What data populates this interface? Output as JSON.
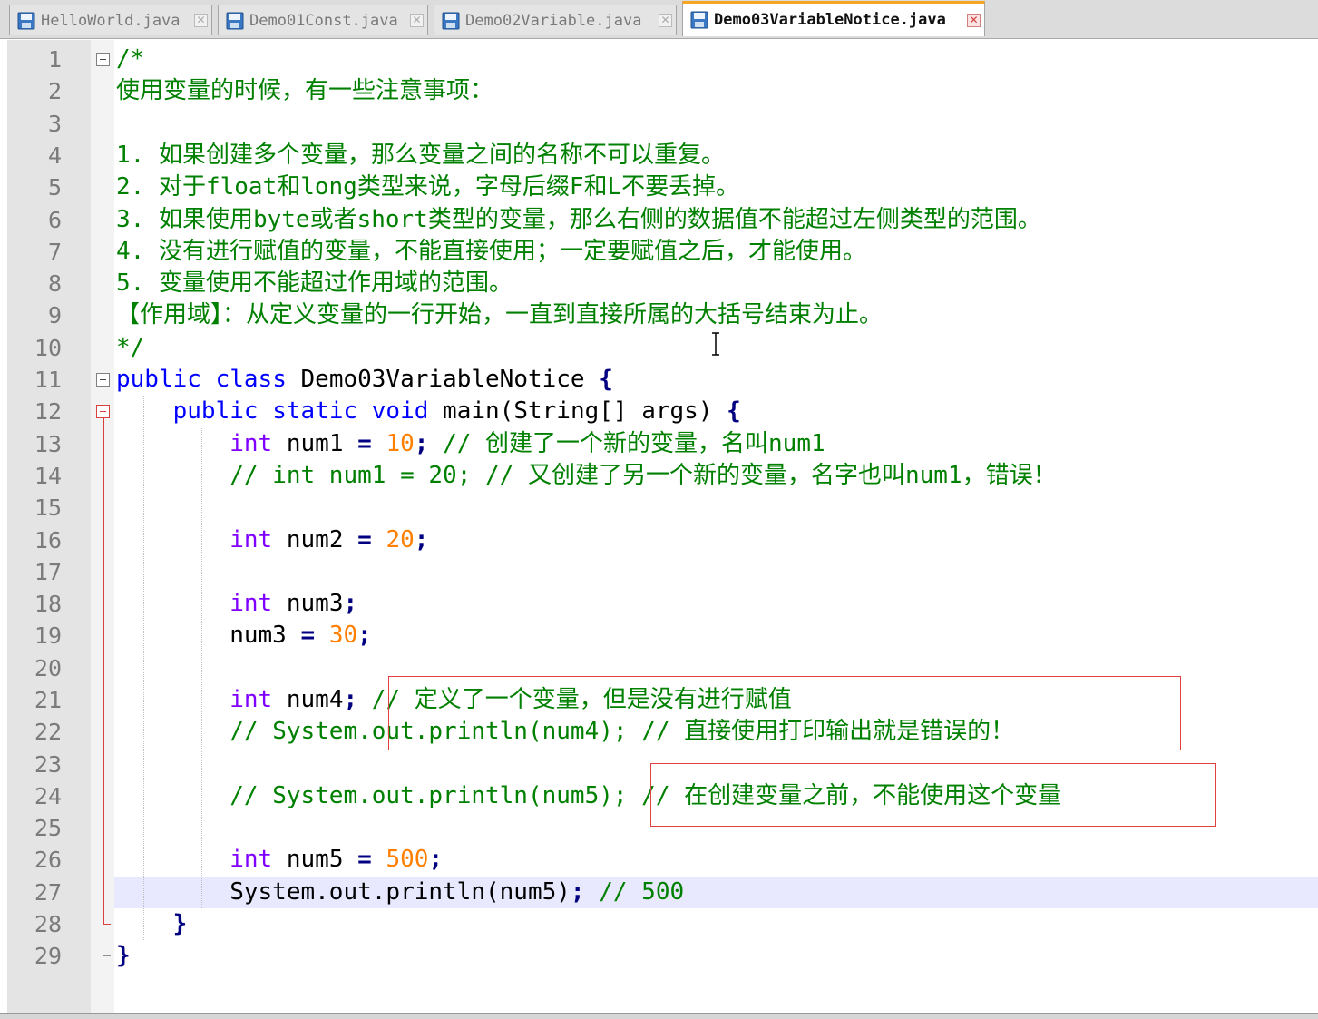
{
  "tabs": [
    {
      "label": "HelloWorld.java",
      "active": false
    },
    {
      "label": "Demo01Const.java",
      "active": false
    },
    {
      "label": "Demo02Variable.java",
      "active": false
    },
    {
      "label": "Demo03VariableNotice.java",
      "active": true
    }
  ],
  "editor": {
    "current_line": 27,
    "lines": [
      {
        "n": "1",
        "tokens": [
          [
            "cmt",
            "/*"
          ]
        ]
      },
      {
        "n": "2",
        "tokens": [
          [
            "cmt",
            "使用变量的时候，有一些注意事项："
          ]
        ]
      },
      {
        "n": "3",
        "tokens": []
      },
      {
        "n": "4",
        "tokens": [
          [
            "cmt",
            "1. 如果创建多个变量，那么变量之间的名称不可以重复。"
          ]
        ]
      },
      {
        "n": "5",
        "tokens": [
          [
            "cmt",
            "2. 对于float和long类型来说，字母后缀F和L不要丢掉。"
          ]
        ]
      },
      {
        "n": "6",
        "tokens": [
          [
            "cmt",
            "3. 如果使用byte或者short类型的变量，那么右侧的数据值不能超过左侧类型的范围。"
          ]
        ]
      },
      {
        "n": "7",
        "tokens": [
          [
            "cmt",
            "4. 没有进行赋值的变量，不能直接使用；一定要赋值之后，才能使用。"
          ]
        ]
      },
      {
        "n": "8",
        "tokens": [
          [
            "cmt",
            "5. 变量使用不能超过作用域的范围。"
          ]
        ]
      },
      {
        "n": "9",
        "tokens": [
          [
            "cmt",
            "【作用域】：从定义变量的一行开始，一直到直接所属的大括号结束为止。"
          ]
        ]
      },
      {
        "n": "10",
        "tokens": [
          [
            "cmt",
            "*/"
          ]
        ]
      },
      {
        "n": "11",
        "tokens": [
          [
            "kw",
            "public"
          ],
          [
            "txt",
            " "
          ],
          [
            "kw",
            "class"
          ],
          [
            "txt",
            " Demo03VariableNotice "
          ],
          [
            "op",
            "{"
          ]
        ]
      },
      {
        "n": "12",
        "tokens": [
          [
            "txt",
            "    "
          ],
          [
            "kw",
            "public"
          ],
          [
            "txt",
            " "
          ],
          [
            "kw",
            "static"
          ],
          [
            "txt",
            " "
          ],
          [
            "kw",
            "void"
          ],
          [
            "txt",
            " main(String[] args) "
          ],
          [
            "op",
            "{"
          ]
        ]
      },
      {
        "n": "13",
        "tokens": [
          [
            "txt",
            "        "
          ],
          [
            "kw2",
            "int"
          ],
          [
            "txt",
            " num1 "
          ],
          [
            "op",
            "="
          ],
          [
            "txt",
            " "
          ],
          [
            "num",
            "10"
          ],
          [
            "op",
            ";"
          ],
          [
            "txt",
            " "
          ],
          [
            "cmt",
            "// 创建了一个新的变量，名叫num1"
          ]
        ]
      },
      {
        "n": "14",
        "tokens": [
          [
            "txt",
            "        "
          ],
          [
            "cmt",
            "// int num1 = 20; // 又创建了另一个新的变量，名字也叫num1，错误！"
          ]
        ]
      },
      {
        "n": "15",
        "tokens": []
      },
      {
        "n": "16",
        "tokens": [
          [
            "txt",
            "        "
          ],
          [
            "kw2",
            "int"
          ],
          [
            "txt",
            " num2 "
          ],
          [
            "op",
            "="
          ],
          [
            "txt",
            " "
          ],
          [
            "num",
            "20"
          ],
          [
            "op",
            ";"
          ]
        ]
      },
      {
        "n": "17",
        "tokens": []
      },
      {
        "n": "18",
        "tokens": [
          [
            "txt",
            "        "
          ],
          [
            "kw2",
            "int"
          ],
          [
            "txt",
            " num3"
          ],
          [
            "op",
            ";"
          ]
        ]
      },
      {
        "n": "19",
        "tokens": [
          [
            "txt",
            "        num3 "
          ],
          [
            "op",
            "="
          ],
          [
            "txt",
            " "
          ],
          [
            "num",
            "30"
          ],
          [
            "op",
            ";"
          ]
        ]
      },
      {
        "n": "20",
        "tokens": []
      },
      {
        "n": "21",
        "tokens": [
          [
            "txt",
            "        "
          ],
          [
            "kw2",
            "int"
          ],
          [
            "txt",
            " num4"
          ],
          [
            "op",
            ";"
          ],
          [
            "txt",
            " "
          ],
          [
            "cmt",
            "// 定义了一个变量，但是没有进行赋值"
          ]
        ]
      },
      {
        "n": "22",
        "tokens": [
          [
            "txt",
            "        "
          ],
          [
            "cmt",
            "// System.out.println(num4); // 直接使用打印输出就是错误的！"
          ]
        ]
      },
      {
        "n": "23",
        "tokens": []
      },
      {
        "n": "24",
        "tokens": [
          [
            "txt",
            "        "
          ],
          [
            "cmt",
            "// System.out.println(num5); // 在创建变量之前，不能使用这个变量"
          ]
        ]
      },
      {
        "n": "25",
        "tokens": []
      },
      {
        "n": "26",
        "tokens": [
          [
            "txt",
            "        "
          ],
          [
            "kw2",
            "int"
          ],
          [
            "txt",
            " num5 "
          ],
          [
            "op",
            "="
          ],
          [
            "txt",
            " "
          ],
          [
            "num",
            "500"
          ],
          [
            "op",
            ";"
          ]
        ]
      },
      {
        "n": "27",
        "tokens": [
          [
            "txt",
            "        System.out.println(num5)"
          ],
          [
            "op",
            ";"
          ],
          [
            "txt",
            " "
          ],
          [
            "cmt",
            "// 500"
          ]
        ]
      },
      {
        "n": "28",
        "tokens": [
          [
            "txt",
            "    "
          ],
          [
            "op",
            "}"
          ]
        ]
      },
      {
        "n": "29",
        "tokens": [
          [
            "op",
            "}"
          ]
        ]
      }
    ]
  },
  "icons": {
    "tab_file": "save-disk-icon",
    "tab_close": "close-icon",
    "fold_minus": "fold-minus-icon",
    "cursor": "text-cursor-icon"
  },
  "colors": {
    "comment": "#008000",
    "keyword": "#0000ff",
    "type": "#8000ff",
    "number": "#ff8000",
    "operator": "#000080",
    "highlight_box": "#e04040",
    "current_line": "#e8e8ff"
  }
}
